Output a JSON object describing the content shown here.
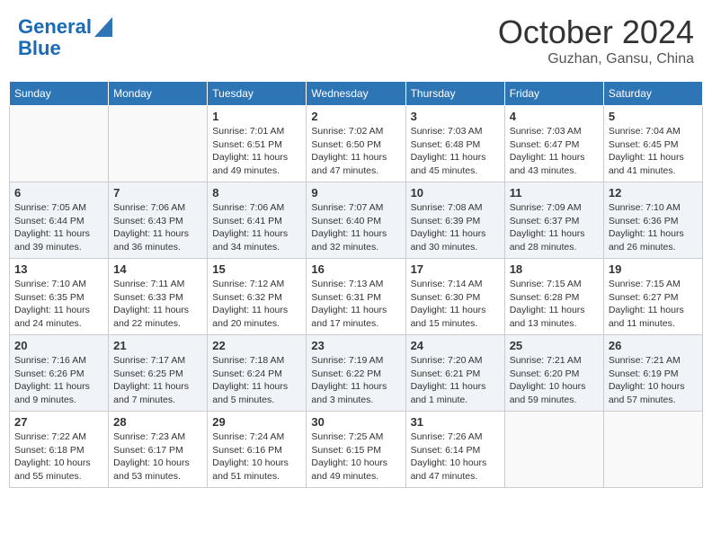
{
  "header": {
    "logo_line1": "General",
    "logo_line2": "Blue",
    "month": "October 2024",
    "location": "Guzhan, Gansu, China"
  },
  "weekdays": [
    "Sunday",
    "Monday",
    "Tuesday",
    "Wednesday",
    "Thursday",
    "Friday",
    "Saturday"
  ],
  "weeks": [
    [
      {
        "day": "",
        "text": ""
      },
      {
        "day": "",
        "text": ""
      },
      {
        "day": "1",
        "text": "Sunrise: 7:01 AM\nSunset: 6:51 PM\nDaylight: 11 hours and 49 minutes."
      },
      {
        "day": "2",
        "text": "Sunrise: 7:02 AM\nSunset: 6:50 PM\nDaylight: 11 hours and 47 minutes."
      },
      {
        "day": "3",
        "text": "Sunrise: 7:03 AM\nSunset: 6:48 PM\nDaylight: 11 hours and 45 minutes."
      },
      {
        "day": "4",
        "text": "Sunrise: 7:03 AM\nSunset: 6:47 PM\nDaylight: 11 hours and 43 minutes."
      },
      {
        "day": "5",
        "text": "Sunrise: 7:04 AM\nSunset: 6:45 PM\nDaylight: 11 hours and 41 minutes."
      }
    ],
    [
      {
        "day": "6",
        "text": "Sunrise: 7:05 AM\nSunset: 6:44 PM\nDaylight: 11 hours and 39 minutes."
      },
      {
        "day": "7",
        "text": "Sunrise: 7:06 AM\nSunset: 6:43 PM\nDaylight: 11 hours and 36 minutes."
      },
      {
        "day": "8",
        "text": "Sunrise: 7:06 AM\nSunset: 6:41 PM\nDaylight: 11 hours and 34 minutes."
      },
      {
        "day": "9",
        "text": "Sunrise: 7:07 AM\nSunset: 6:40 PM\nDaylight: 11 hours and 32 minutes."
      },
      {
        "day": "10",
        "text": "Sunrise: 7:08 AM\nSunset: 6:39 PM\nDaylight: 11 hours and 30 minutes."
      },
      {
        "day": "11",
        "text": "Sunrise: 7:09 AM\nSunset: 6:37 PM\nDaylight: 11 hours and 28 minutes."
      },
      {
        "day": "12",
        "text": "Sunrise: 7:10 AM\nSunset: 6:36 PM\nDaylight: 11 hours and 26 minutes."
      }
    ],
    [
      {
        "day": "13",
        "text": "Sunrise: 7:10 AM\nSunset: 6:35 PM\nDaylight: 11 hours and 24 minutes."
      },
      {
        "day": "14",
        "text": "Sunrise: 7:11 AM\nSunset: 6:33 PM\nDaylight: 11 hours and 22 minutes."
      },
      {
        "day": "15",
        "text": "Sunrise: 7:12 AM\nSunset: 6:32 PM\nDaylight: 11 hours and 20 minutes."
      },
      {
        "day": "16",
        "text": "Sunrise: 7:13 AM\nSunset: 6:31 PM\nDaylight: 11 hours and 17 minutes."
      },
      {
        "day": "17",
        "text": "Sunrise: 7:14 AM\nSunset: 6:30 PM\nDaylight: 11 hours and 15 minutes."
      },
      {
        "day": "18",
        "text": "Sunrise: 7:15 AM\nSunset: 6:28 PM\nDaylight: 11 hours and 13 minutes."
      },
      {
        "day": "19",
        "text": "Sunrise: 7:15 AM\nSunset: 6:27 PM\nDaylight: 11 hours and 11 minutes."
      }
    ],
    [
      {
        "day": "20",
        "text": "Sunrise: 7:16 AM\nSunset: 6:26 PM\nDaylight: 11 hours and 9 minutes."
      },
      {
        "day": "21",
        "text": "Sunrise: 7:17 AM\nSunset: 6:25 PM\nDaylight: 11 hours and 7 minutes."
      },
      {
        "day": "22",
        "text": "Sunrise: 7:18 AM\nSunset: 6:24 PM\nDaylight: 11 hours and 5 minutes."
      },
      {
        "day": "23",
        "text": "Sunrise: 7:19 AM\nSunset: 6:22 PM\nDaylight: 11 hours and 3 minutes."
      },
      {
        "day": "24",
        "text": "Sunrise: 7:20 AM\nSunset: 6:21 PM\nDaylight: 11 hours and 1 minute."
      },
      {
        "day": "25",
        "text": "Sunrise: 7:21 AM\nSunset: 6:20 PM\nDaylight: 10 hours and 59 minutes."
      },
      {
        "day": "26",
        "text": "Sunrise: 7:21 AM\nSunset: 6:19 PM\nDaylight: 10 hours and 57 minutes."
      }
    ],
    [
      {
        "day": "27",
        "text": "Sunrise: 7:22 AM\nSunset: 6:18 PM\nDaylight: 10 hours and 55 minutes."
      },
      {
        "day": "28",
        "text": "Sunrise: 7:23 AM\nSunset: 6:17 PM\nDaylight: 10 hours and 53 minutes."
      },
      {
        "day": "29",
        "text": "Sunrise: 7:24 AM\nSunset: 6:16 PM\nDaylight: 10 hours and 51 minutes."
      },
      {
        "day": "30",
        "text": "Sunrise: 7:25 AM\nSunset: 6:15 PM\nDaylight: 10 hours and 49 minutes."
      },
      {
        "day": "31",
        "text": "Sunrise: 7:26 AM\nSunset: 6:14 PM\nDaylight: 10 hours and 47 minutes."
      },
      {
        "day": "",
        "text": ""
      },
      {
        "day": "",
        "text": ""
      }
    ]
  ]
}
